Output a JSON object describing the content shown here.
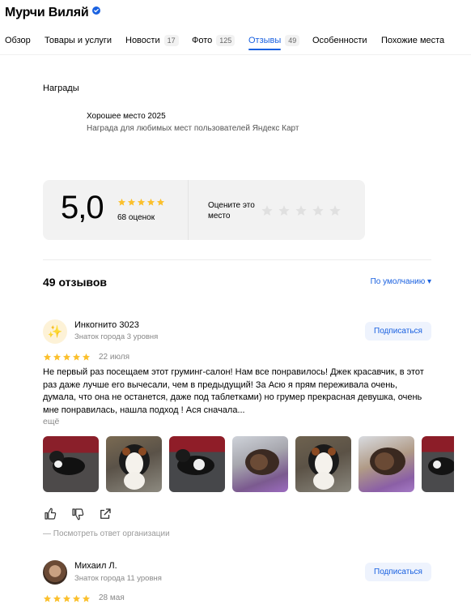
{
  "header": {
    "title": "Мурчи Виляй"
  },
  "tabs": [
    {
      "label": "Обзор",
      "count": ""
    },
    {
      "label": "Товары и услуги",
      "count": ""
    },
    {
      "label": "Новости",
      "count": "17"
    },
    {
      "label": "Фото",
      "count": "125"
    },
    {
      "label": "Отзывы",
      "count": "49"
    },
    {
      "label": "Особенности",
      "count": ""
    },
    {
      "label": "Похожие места",
      "count": ""
    }
  ],
  "active_tab": "Отзывы",
  "awards": {
    "heading": "Награды",
    "title": "Хорошее место 2025",
    "subtitle": "Награда для любимых мест пользователей Яндекс Карт"
  },
  "rating": {
    "value": "5,0",
    "stars": 5,
    "count_label": "68 оценок",
    "rate_prompt": "Оцените это место"
  },
  "reviews_header": {
    "count_label": "49 отзывов",
    "sort_label": "По умолчанию ▾"
  },
  "reviews": [
    {
      "author": "Инкогнито 3023",
      "level": "Знаток города 3 уровня",
      "subscribe_label": "Подписаться",
      "stars": 5,
      "date": "22 июля",
      "text": "Не первый раз посещаем этот груминг-салон! Нам все понравилось! Джек красавчик, в этот раз даже лучше его вычесали, чем в предыдущий! За Асю я прям переживала очень, думала, что она не останется, даже под таблетками) но грумер прекрасная девушка, очень мне понравилась, нашла подход ! Ася сначала...",
      "more_label": "ещё",
      "org_answer_label": "— Посмотреть ответ организации"
    },
    {
      "author": "Михаил Л.",
      "level": "Знаток города 11 уровня",
      "subscribe_label": "Подписаться",
      "stars": 5,
      "date": "28 мая"
    }
  ],
  "colors": {
    "accent": "#1a61e0",
    "star_gold": "#fbc02d",
    "star_empty": "#e0e0e0"
  }
}
